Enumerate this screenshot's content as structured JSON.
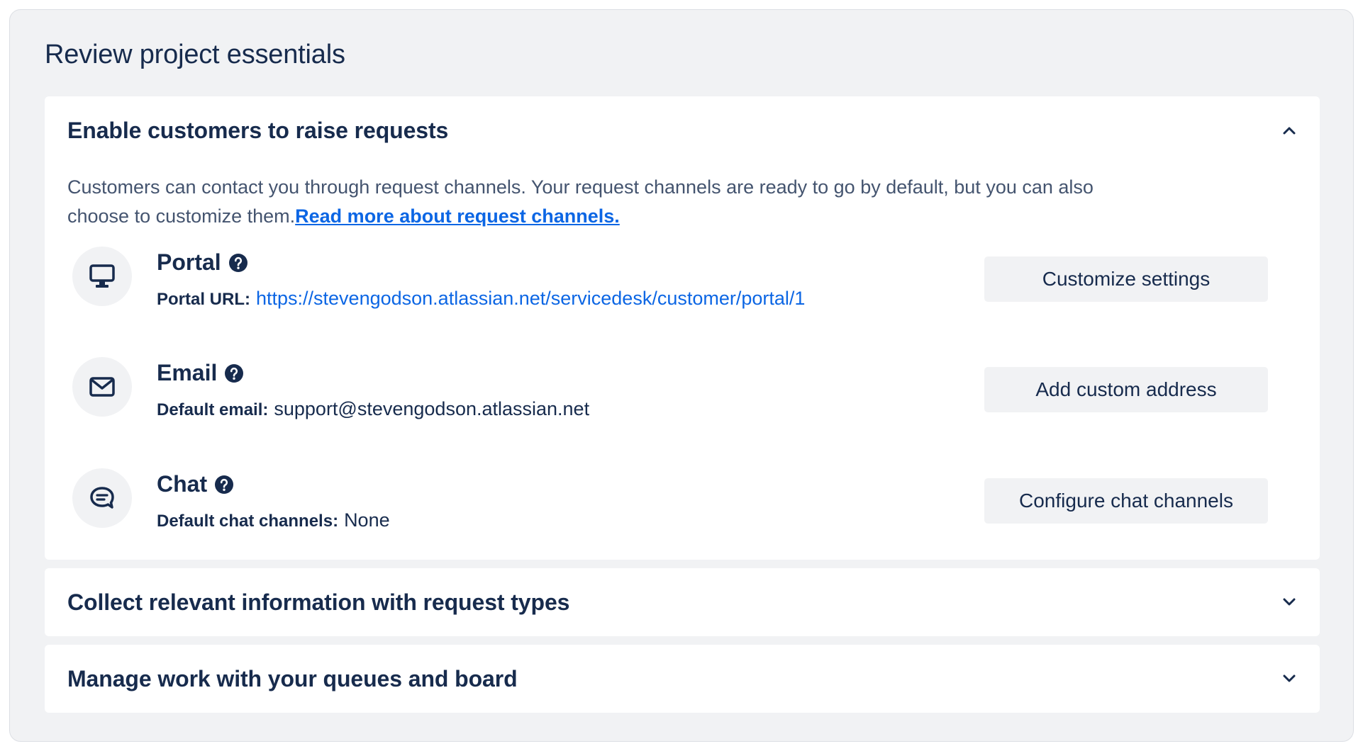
{
  "page": {
    "title": "Review project essentials"
  },
  "sections": [
    {
      "title": "Enable customers to raise requests",
      "expanded": true,
      "description": "Customers can contact you through request channels. Your request channels are ready to go by default, but you can also choose to customize them.",
      "link_text": "Read more about request channels.",
      "channels": [
        {
          "name": "Portal",
          "icon": "monitor-icon",
          "detail_label": "Portal URL:",
          "detail_value": "https://stevengodson.atlassian.net/servicedesk/customer/portal/1",
          "button_label": "Customize settings"
        },
        {
          "name": "Email",
          "icon": "envelope-icon",
          "detail_label": "Default email:",
          "detail_value": "support@stevengodson.atlassian.net",
          "button_label": "Add custom address"
        },
        {
          "name": "Chat",
          "icon": "chat-bubble-icon",
          "detail_label": "Default chat channels:",
          "detail_value": "None",
          "button_label": "Configure chat channels"
        }
      ]
    },
    {
      "title": "Collect relevant information with request types",
      "expanded": false
    },
    {
      "title": "Manage work with your queues and board",
      "expanded": false
    }
  ],
  "colors": {
    "text": "#172b4d",
    "subtle_text": "#44546f",
    "link": "#0c66e4",
    "background": "#f1f2f4",
    "panel": "#ffffff"
  }
}
